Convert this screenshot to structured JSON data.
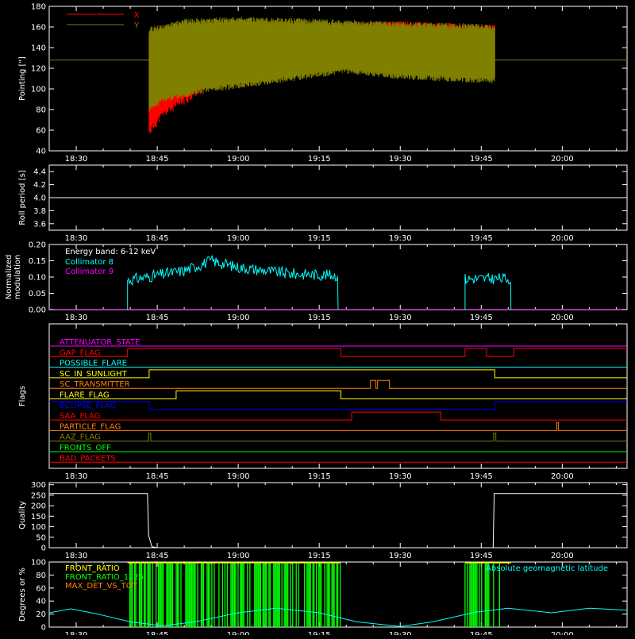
{
  "time_axis": {
    "ticks": [
      "18:30",
      "18:45",
      "19:00",
      "19:15",
      "19:30",
      "19:45",
      "20:00"
    ],
    "start_min": 1105,
    "end_min": 1212,
    "tick_minutes": [
      1110,
      1125,
      1140,
      1155,
      1170,
      1185,
      1200
    ]
  },
  "chart_data": [
    {
      "id": "pointing",
      "type": "line",
      "ylabel": "Pointing [\"]",
      "ylim": [
        40,
        180
      ],
      "yticks": [
        40,
        60,
        80,
        100,
        120,
        140,
        160,
        180
      ],
      "legend": [
        {
          "name": "X",
          "color": "#ff0000"
        },
        {
          "name": "Y",
          "color": "#808000"
        }
      ],
      "series": [
        {
          "name": "X",
          "color": "#ff0000",
          "active": [
            1123.5,
            1187.5
          ],
          "envelope_upper": [
            [
              1123.5,
              150
            ],
            [
              1135,
              155
            ],
            [
              1150,
              158
            ],
            [
              1160,
              162
            ],
            [
              1170,
              164
            ],
            [
              1187,
              160
            ]
          ],
          "envelope_lower": [
            [
              1123.5,
              58
            ],
            [
              1126,
              75
            ],
            [
              1135,
              105
            ],
            [
              1145,
              115
            ],
            [
              1160,
              122
            ],
            [
              1170,
              118
            ],
            [
              1187,
              115
            ]
          ]
        },
        {
          "name": "Y",
          "color": "#808000",
          "baseline": 128,
          "active": [
            1123.5,
            1187.5
          ],
          "envelope_upper": [
            [
              1123.5,
              160
            ],
            [
              1130,
              168
            ],
            [
              1140,
              170
            ],
            [
              1155,
              168
            ],
            [
              1170,
              165
            ],
            [
              1187,
              163
            ]
          ],
          "envelope_lower": [
            [
              1123.5,
              80
            ],
            [
              1126,
              90
            ],
            [
              1135,
              100
            ],
            [
              1150,
              110
            ],
            [
              1160,
              118
            ],
            [
              1170,
              112
            ],
            [
              1187,
              108
            ]
          ]
        }
      ]
    },
    {
      "id": "roll",
      "type": "line",
      "ylabel": "Roll period [s]",
      "ylim": [
        3.5,
        4.5
      ],
      "yticks": [
        3.6,
        3.8,
        4.0,
        4.2,
        4.4
      ],
      "series": [
        {
          "name": "",
          "color": "#ffffff",
          "constant": 4.0
        }
      ]
    },
    {
      "id": "modulation",
      "type": "line",
      "ylabel": "Normalized modulation",
      "ylim": [
        0,
        0.2
      ],
      "yticks": [
        "0.00",
        "0.05",
        "0.10",
        "0.15",
        "0.20"
      ],
      "annotation": "Energy band: 6-12 keV",
      "legend": [
        {
          "name": "Collimator 8",
          "color": "#00ffff"
        },
        {
          "name": "Collimator 9",
          "color": "#ff00ff"
        }
      ],
      "series": [
        {
          "name": "Collimator 8",
          "color": "#00ffff",
          "segments": [
            [
              1119.5,
              1158.5
            ],
            [
              1182,
              1190.5
            ]
          ],
          "level": [
            [
              1119.5,
              0.09
            ],
            [
              1130,
              0.12
            ],
            [
              1135,
              0.15
            ],
            [
              1140,
              0.13
            ],
            [
              1150,
              0.11
            ],
            [
              1158.5,
              0.105
            ],
            [
              1182,
              0.095
            ],
            [
              1190.5,
              0.095
            ]
          ]
        },
        {
          "name": "Collimator 9",
          "color": "#ff00ff",
          "constant": 0.0
        }
      ]
    },
    {
      "id": "flags",
      "type": "line",
      "ylabel": "Flags",
      "flags": [
        {
          "name": "ATTENUATOR_STATE",
          "color": "#ff00ff",
          "steps": [
            [
              1105,
              0
            ]
          ]
        },
        {
          "name": "GAP_FLAG",
          "color": "#ff0000",
          "steps": [
            [
              1105,
              0
            ],
            [
              1119.5,
              1
            ],
            [
              1159,
              0
            ],
            [
              1182,
              1
            ],
            [
              1186,
              0
            ],
            [
              1191,
              1
            ]
          ]
        },
        {
          "name": "POSSIBLE_FLARE",
          "color": "#00ffff",
          "steps": [
            [
              1105,
              0
            ]
          ]
        },
        {
          "name": "SC_IN_SUNLIGHT",
          "color": "#ffff00",
          "steps": [
            [
              1105,
              0
            ],
            [
              1123.5,
              1
            ],
            [
              1187.5,
              0
            ]
          ]
        },
        {
          "name": "SC_TRANSMITTER",
          "color": "#ff8000",
          "steps": [
            [
              1105,
              0
            ],
            [
              1164.5,
              1
            ],
            [
              1165.5,
              0
            ],
            [
              1165.8,
              1
            ],
            [
              1168,
              0
            ]
          ]
        },
        {
          "name": "FLARE_FLAG",
          "color": "#ffff00",
          "steps": [
            [
              1105,
              0
            ],
            [
              1128.5,
              1
            ],
            [
              1159,
              0
            ]
          ]
        },
        {
          "name": "ECLIPSE_FLAG",
          "color": "#0000ff",
          "steps": [
            [
              1105,
              1
            ],
            [
              1123.5,
              0
            ],
            [
              1187.5,
              1
            ]
          ]
        },
        {
          "name": "SAA_FLAG",
          "color": "#ff0000",
          "steps": [
            [
              1105,
              0
            ],
            [
              1161,
              1
            ],
            [
              1177.5,
              0
            ]
          ]
        },
        {
          "name": "PARTICLE_FLAG",
          "color": "#ff8000",
          "steps": [
            [
              1105,
              0
            ],
            [
              1199,
              1
            ],
            [
              1199.3,
              0
            ]
          ]
        },
        {
          "name": "AAZ_FLAG",
          "color": "#808000",
          "steps": [
            [
              1105,
              0
            ],
            [
              1123.4,
              1
            ],
            [
              1123.8,
              0
            ],
            [
              1187.3,
              1
            ],
            [
              1187.7,
              0
            ]
          ]
        },
        {
          "name": "FRONTS_OFF",
          "color": "#00ff00",
          "steps": [
            [
              1105,
              0
            ]
          ]
        },
        {
          "name": "BAD_PACKETS",
          "color": "#ff0000",
          "steps": [
            [
              1105,
              0
            ]
          ]
        }
      ]
    },
    {
      "id": "quality",
      "type": "line",
      "ylabel": "Quality",
      "ylim": [
        0,
        310
      ],
      "yticks": [
        0,
        50,
        100,
        150,
        200,
        250,
        300
      ],
      "series": [
        {
          "name": "",
          "color": "#ffffff",
          "points": [
            [
              1105,
              258
            ],
            [
              1123.2,
              258
            ],
            [
              1123.4,
              60
            ],
            [
              1124,
              5
            ],
            [
              1125,
              0
            ],
            [
              1187.2,
              0
            ],
            [
              1187.4,
              258
            ],
            [
              1212,
              258
            ]
          ]
        }
      ]
    },
    {
      "id": "ratios",
      "type": "line",
      "ylabel": "Degrees or %",
      "ylim": [
        0,
        100
      ],
      "yticks": [
        0,
        20,
        40,
        60,
        80,
        100
      ],
      "legend": [
        {
          "name": "FRONT_RATIO",
          "color": "#ffff00"
        },
        {
          "name": "FRONT_RATIO_1225",
          "color": "#00ff00"
        },
        {
          "name": "MAX_DET_VS_TOT",
          "color": "#ff8000"
        }
      ],
      "right_label": {
        "text": "Absolute geomagnetic latitude",
        "color": "#00ffff"
      },
      "series": [
        {
          "name": "FRONT_RATIO_1225",
          "color": "#00ff00",
          "segments": [
            [
              1119.5,
              1159
            ],
            [
              1182,
              1190.5
            ]
          ]
        },
        {
          "name": "Absolute geomagnetic latitude",
          "color": "#00ffff",
          "points": [
            [
              1105,
              22
            ],
            [
              1109,
              28
            ],
            [
              1114,
              20
            ],
            [
              1120,
              8
            ],
            [
              1126,
              2
            ],
            [
              1132,
              8
            ],
            [
              1140,
              22
            ],
            [
              1147,
              29
            ],
            [
              1155,
              22
            ],
            [
              1162,
              8
            ],
            [
              1170,
              1
            ],
            [
              1176,
              8
            ],
            [
              1184,
              23
            ],
            [
              1190,
              29
            ],
            [
              1198,
              22
            ],
            [
              1205,
              29
            ],
            [
              1212,
              26
            ]
          ]
        }
      ]
    }
  ]
}
